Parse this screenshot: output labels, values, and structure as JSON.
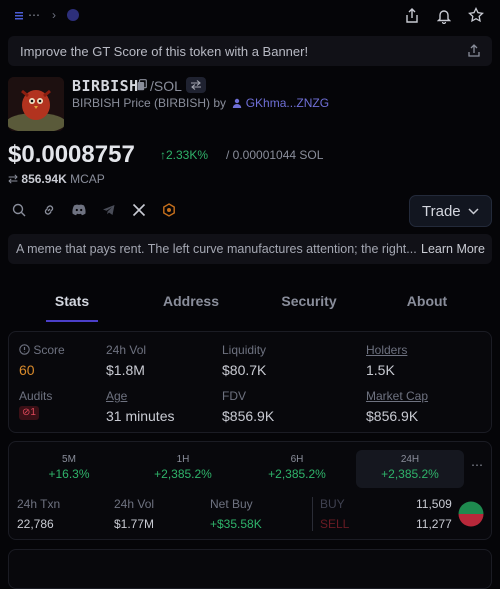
{
  "banner": {
    "text": "Improve the GT Score of this token with a Banner!"
  },
  "token": {
    "symbol": "BIRBISH",
    "pair_quote": "/SOL",
    "full_name": "BIRBISH Price (BIRBISH) by",
    "creator": "GKhma...ZNZG",
    "price": "$0.0008757",
    "change_pct": "2.33K%",
    "price_native": "/ 0.00001044 SOL",
    "mcap_value": "856.94K",
    "mcap_label": "MCAP"
  },
  "trade_button": {
    "label": "Trade"
  },
  "description": {
    "text": "A meme that pays rent. The left curve manufactures attention; the right...",
    "learn_more": "Learn More"
  },
  "tabs": [
    "Stats",
    "Address",
    "Security",
    "About"
  ],
  "stats": {
    "score_label": "Score",
    "score_value": "60",
    "vol24_label": "24h Vol",
    "vol24_value": "$1.8M",
    "liquidity_label": "Liquidity",
    "liquidity_value": "$80.7K",
    "holders_label": "Holders",
    "holders_value": "1.5K",
    "audits_label": "Audits",
    "audits_value": "1",
    "age_label": "Age",
    "age_value": "31 minutes",
    "fdv_label": "FDV",
    "fdv_value": "$856.9K",
    "marketcap_label": "Market Cap",
    "marketcap_value": "$856.9K"
  },
  "timeframes": [
    {
      "name": "5M",
      "pct": "+16.3%"
    },
    {
      "name": "1H",
      "pct": "+2,385.2%"
    },
    {
      "name": "6H",
      "pct": "+2,385.2%"
    },
    {
      "name": "24H",
      "pct": "+2,385.2%"
    }
  ],
  "txn": {
    "txn_label": "24h Txn",
    "txn_value": "22,786",
    "vol_label": "24h Vol",
    "vol_value": "$1.77M",
    "netbuy_label": "Net Buy",
    "netbuy_value": "+$35.58K",
    "buy_label": "BUY",
    "buy_value": "11,509",
    "sell_label": "SELL",
    "sell_value": "11,277"
  },
  "colors": {
    "accent": "#4b3fc9",
    "up": "#2fb36a",
    "down": "#e0495b",
    "score": "#d98a2b"
  }
}
